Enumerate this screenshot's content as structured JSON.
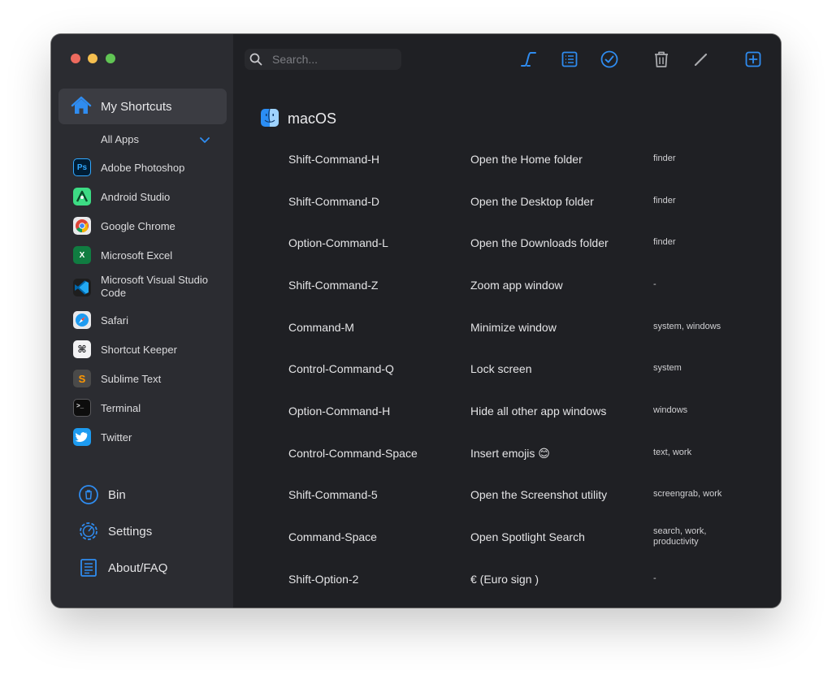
{
  "sidebar": {
    "home_label": "My Shortcuts",
    "filter_label": "All Apps",
    "apps": [
      {
        "label": "Adobe Photoshop",
        "icon": "photoshop-icon",
        "glyph": "Ps"
      },
      {
        "label": "Android Studio",
        "icon": "android-studio-icon",
        "glyph": ""
      },
      {
        "label": "Google Chrome",
        "icon": "chrome-icon",
        "glyph": ""
      },
      {
        "label": "Microsoft Excel",
        "icon": "excel-icon",
        "glyph": "X"
      },
      {
        "label": "Microsoft Visual Studio Code",
        "icon": "vscode-icon",
        "glyph": ""
      },
      {
        "label": "Safari",
        "icon": "safari-icon",
        "glyph": ""
      },
      {
        "label": "Shortcut Keeper",
        "icon": "shortcut-keeper-icon",
        "glyph": "⌘"
      },
      {
        "label": "Sublime Text",
        "icon": "sublime-text-icon",
        "glyph": "S"
      },
      {
        "label": "Terminal",
        "icon": "terminal-icon",
        "glyph": ">_"
      },
      {
        "label": "Twitter",
        "icon": "twitter-icon",
        "glyph": ""
      }
    ],
    "bottom": {
      "bin_label": "Bin",
      "settings_label": "Settings",
      "about_label": "About/FAQ"
    }
  },
  "toolbar": {
    "search_placeholder": "Search..."
  },
  "section": {
    "title": "macOS",
    "icon": "finder-icon"
  },
  "shortcuts": [
    {
      "keys": "Shift-Command-H",
      "description": "Open the Home folder",
      "tags": "finder"
    },
    {
      "keys": "Shift-Command-D",
      "description": "Open the Desktop folder",
      "tags": "finder"
    },
    {
      "keys": "Option-Command-L",
      "description": "Open the Downloads folder",
      "tags": "finder"
    },
    {
      "keys": "Shift-Command-Z",
      "description": "Zoom app window",
      "tags": "-"
    },
    {
      "keys": "Command-M",
      "description": "Minimize window",
      "tags": "system, windows"
    },
    {
      "keys": "Control-Command-Q",
      "description": "Lock screen",
      "tags": "system"
    },
    {
      "keys": "Option-Command-H",
      "description": "Hide all other app windows",
      "tags": "windows"
    },
    {
      "keys": "Control-Command-Space",
      "description": "Insert emojis 😊",
      "tags": "text, work"
    },
    {
      "keys": "Shift-Command-5",
      "description": "Open the Screenshot utility",
      "tags": "screengrab, work"
    },
    {
      "keys": "Command-Space",
      "description": "Open Spotlight Search",
      "tags": "search, work, productivity"
    },
    {
      "keys": "Shift-Option-2",
      "description": "€ (Euro sign )",
      "tags": "-"
    }
  ],
  "colors": {
    "accent": "#2f8cf0",
    "sidebar_bg": "#2b2c31",
    "main_bg": "#1f2024",
    "selected_bg": "#3b3c42"
  }
}
